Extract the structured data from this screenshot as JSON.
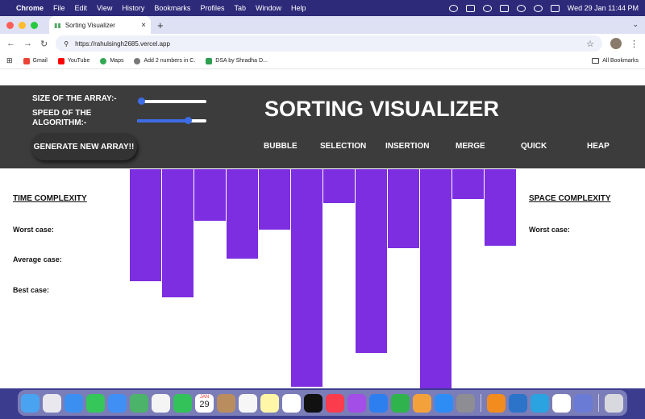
{
  "menubar": {
    "app": "Chrome",
    "menus": [
      "File",
      "Edit",
      "View",
      "History",
      "Bookmarks",
      "Profiles",
      "Tab",
      "Window",
      "Help"
    ],
    "datetime": "Wed 29 Jan  11:44 PM"
  },
  "browser": {
    "tab_title": "Sorting Visualizer",
    "url": "https://rahulsingh2685.vercel.app",
    "bookmarks": [
      "Gmail",
      "YouTube",
      "Maps",
      "Add 2 numbers in C.",
      "DSA by Shradha D..."
    ],
    "all_bookmarks": "All Bookmarks"
  },
  "app": {
    "size_label": "SIZE OF THE ARRAY:-",
    "speed_label_line1": "SPEED OF THE",
    "speed_label_line2": "ALGORITHM:-",
    "size_value_fraction": 0.03,
    "speed_value_fraction": 0.73,
    "generate_button": "GENERATE NEW ARRAY!!",
    "title": "SORTING VISUALIZER",
    "algorithms": [
      "BUBBLE",
      "SELECTION",
      "INSERTION",
      "MERGE",
      "QUICK",
      "HEAP"
    ],
    "time_complexity": {
      "heading": "TIME COMPLEXITY",
      "worst": "Worst case:",
      "average": "Average case:",
      "best": "Best case:"
    },
    "space_complexity": {
      "heading": "SPACE COMPLEXITY",
      "worst": "Worst case:"
    },
    "bar_color": "#7c2ee0",
    "array_values": [
      141,
      161,
      66,
      113,
      77,
      272,
      44,
      230,
      100,
      275,
      39,
      97
    ]
  },
  "dock": {
    "apps": [
      "finder-icon",
      "launchpad-icon",
      "safari-icon",
      "messages-icon",
      "mail-icon",
      "maps-icon",
      "photos-icon",
      "facetime-icon",
      "calendar-icon",
      "contacts-icon",
      "reminders-icon",
      "notes-icon",
      "freeform-icon",
      "tv-icon",
      "music-icon",
      "podcasts-icon",
      "keynote-icon",
      "numbers-icon",
      "pages-icon",
      "app-store-icon",
      "system-settings-icon",
      "vlc-icon",
      "vscode-icon",
      "telegram-icon",
      "chrome-icon",
      "preview-icon",
      "trash-icon"
    ],
    "calendar_month": "JAN",
    "calendar_day": "29"
  }
}
